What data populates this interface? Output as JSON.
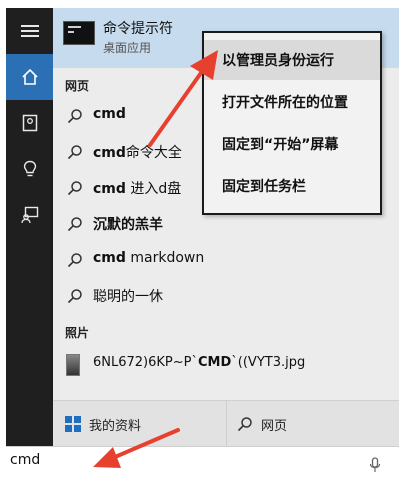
{
  "best_match": {
    "title": "命令提示符",
    "subtitle": "桌面应用",
    "icon": "cmd-window-icon"
  },
  "sections": {
    "web": "网页",
    "photos": "照片"
  },
  "suggestions": [
    {
      "bold": "cmd",
      "rest": ""
    },
    {
      "bold": "cmd",
      "rest": "命令大全"
    },
    {
      "bold": "cmd",
      "rest": " 进入d盘"
    },
    {
      "bold": "沉默的羔羊",
      "rest": ""
    },
    {
      "bold": "cmd",
      "rest": " markdown"
    },
    {
      "bold": "",
      "rest": "聪明的一休"
    }
  ],
  "photo": {
    "pre": "6NL672)6KP~P`",
    "bold": "CMD",
    "post": "`((VYT3.jpg"
  },
  "bottom_tabs": {
    "my_stuff": "我的资料",
    "web": "网页"
  },
  "search": {
    "value": "cmd"
  },
  "context_menu": [
    {
      "label": "以管理员身份运行"
    },
    {
      "label": "打开文件所在的位置"
    },
    {
      "label": "固定到“开始”屏幕"
    },
    {
      "label": "固定到任务栏"
    }
  ],
  "colors": {
    "accent": "#2b6fb4",
    "best_match_bg": "#c7dbee",
    "arrow": "#e8402e"
  }
}
